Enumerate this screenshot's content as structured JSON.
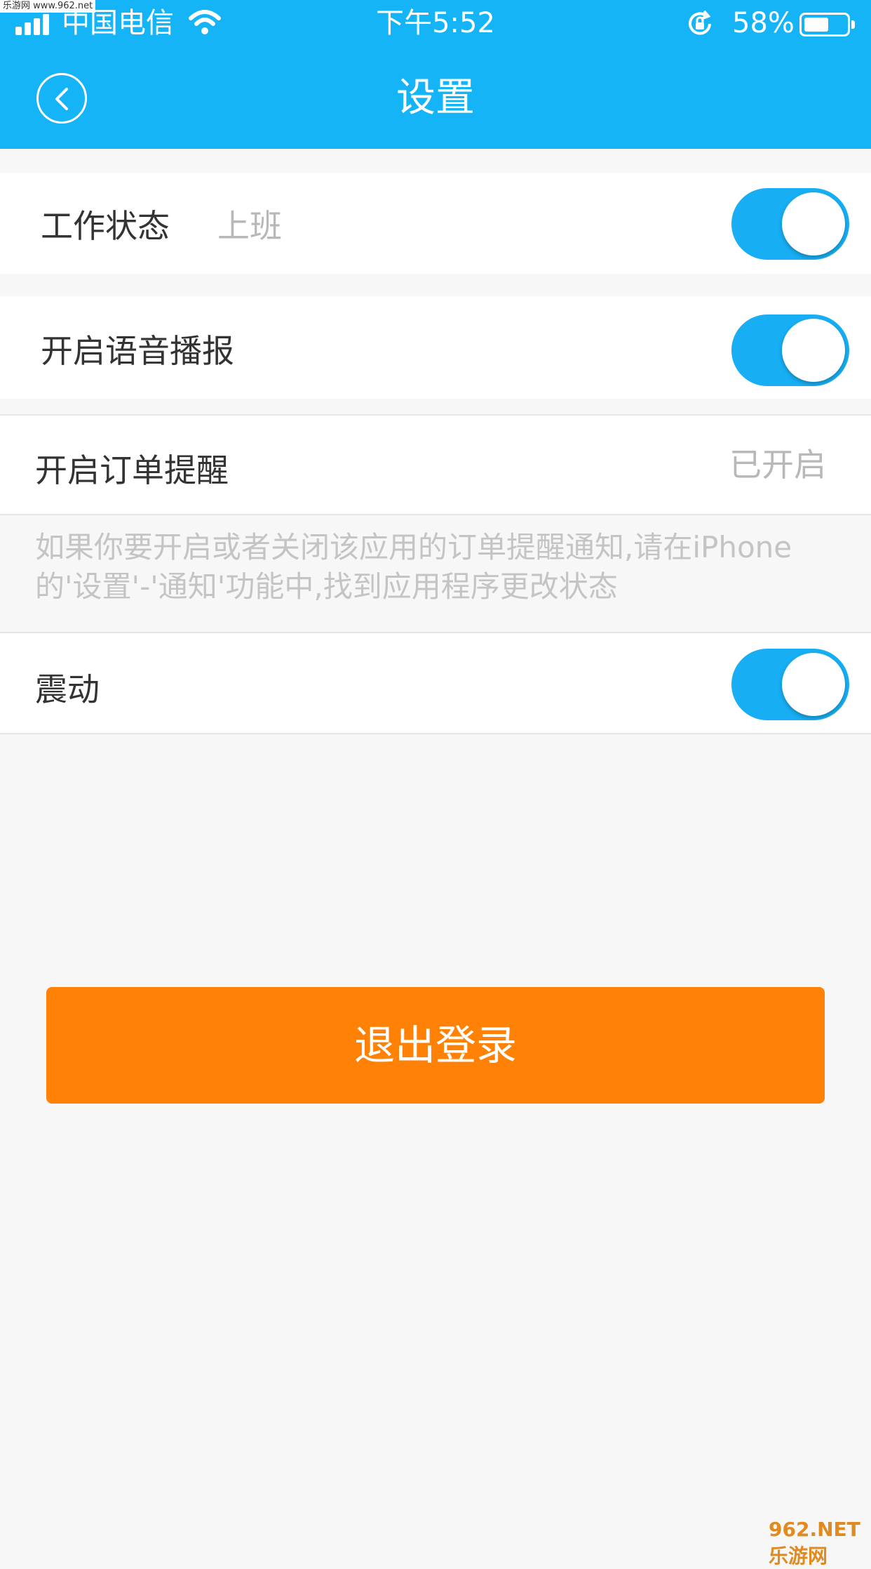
{
  "watermark_top": "乐游网 www.962.net",
  "status_bar": {
    "carrier": "中国电信",
    "time": "下午5:52",
    "battery_percent": "58%",
    "battery_level": 0.58
  },
  "header": {
    "title": "设置",
    "bg_color": "#14b4f7"
  },
  "settings": {
    "work_status": {
      "label": "工作状态",
      "value": "上班",
      "toggle_on": true
    },
    "voice_broadcast": {
      "label": "开启语音播报",
      "toggle_on": true
    },
    "order_reminder": {
      "label": "开启订单提醒",
      "value": "已开启"
    },
    "hint": "如果你要开启或者关闭该应用的订单提醒通知,请在iPhone的'设置'-'通知'功能中,找到应用程序更改状态",
    "vibrate": {
      "label": "震动",
      "toggle_on": true
    }
  },
  "logout_button": {
    "label": "退出登录",
    "color": "#ff8206"
  },
  "watermark_bottom": "962.NET 乐游网"
}
